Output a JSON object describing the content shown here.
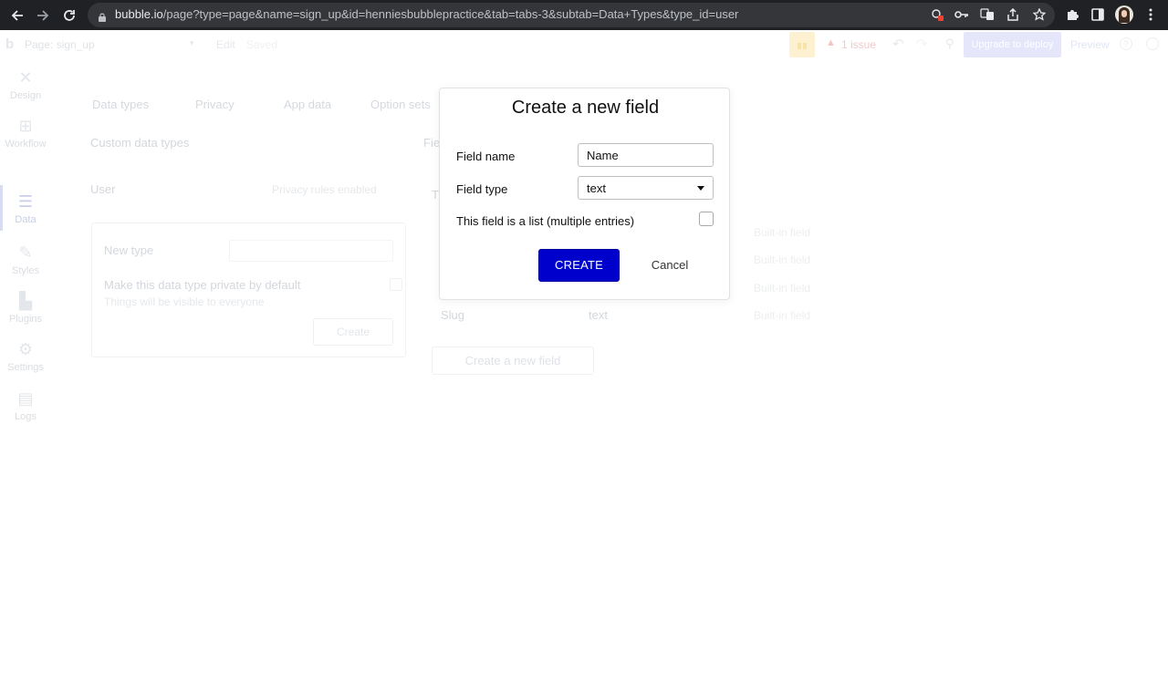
{
  "browser": {
    "url_host": "bubble.io",
    "url_path": "/page?type=page&name=sign_up&id=henniesbubblepractice&tab=tabs-3&subtab=Data+Types&type_id=user"
  },
  "topbar": {
    "page_selector": "Page: sign_up",
    "edit_label": "Edit",
    "saved_status": "Saved",
    "issues": "1 issue",
    "upgrade_button": "Upgrade to deploy",
    "preview_button": "Preview"
  },
  "sidebar": {
    "items": [
      {
        "label": "Design",
        "icon": "design-icon"
      },
      {
        "label": "Workflow",
        "icon": "workflow-icon"
      },
      {
        "label": "Data",
        "icon": "data-icon"
      },
      {
        "label": "Styles",
        "icon": "styles-icon"
      },
      {
        "label": "Plugins",
        "icon": "plugins-icon"
      },
      {
        "label": "Settings",
        "icon": "settings-icon"
      },
      {
        "label": "Logs",
        "icon": "logs-icon"
      }
    ],
    "active": "Data"
  },
  "data_tabs": [
    "Data types",
    "Privacy",
    "App data",
    "Option sets"
  ],
  "main": {
    "custom_types_heading": "Custom data types",
    "fields_heading_partial": "Fie",
    "type_row_name": "User",
    "type_row_status": "Privacy rules enabled",
    "new_type_label": "New type",
    "private_default": "Make this data type private by default",
    "visible_hint": "Things will be visible to everyone",
    "create_ghost": "Create",
    "field_row_t": "T",
    "slug_label": "Slug",
    "slug_type": "text",
    "builtin_labels": [
      "Built-in field",
      "Built-in field",
      "Built-in field",
      "Built-in field"
    ],
    "create_field_button": "Create a new field"
  },
  "modal": {
    "title": "Create a new field",
    "field_name_label": "Field name",
    "field_name_value": "Name",
    "field_type_label": "Field type",
    "field_type_value": "text",
    "list_label": "This field is a list (multiple entries)",
    "list_checked": false,
    "create_button": "CREATE",
    "cancel_button": "Cancel"
  },
  "colors": {
    "primary_button": "#0000cc",
    "chrome_bg": "#202124"
  }
}
